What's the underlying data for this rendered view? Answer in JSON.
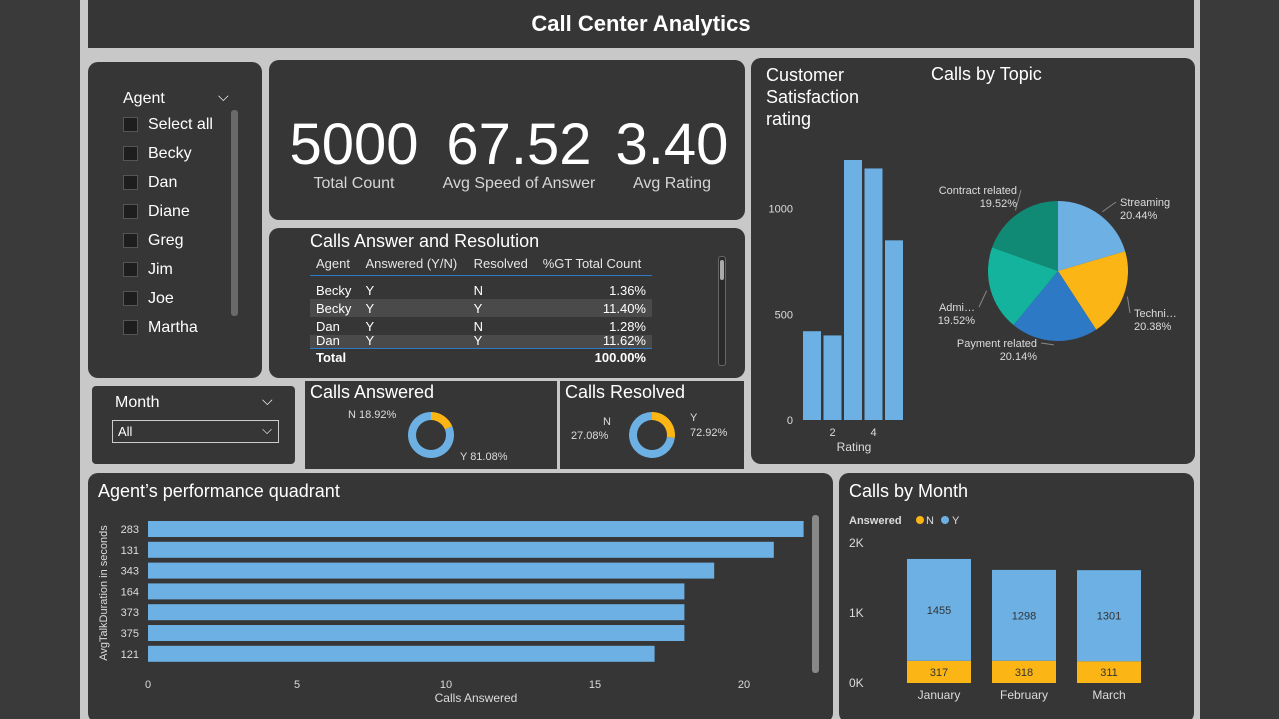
{
  "header": {
    "title": "Call Center Analytics"
  },
  "agent_slicer": {
    "label": "Agent",
    "items": [
      {
        "label": "Select all"
      },
      {
        "label": "Becky"
      },
      {
        "label": "Dan"
      },
      {
        "label": "Diane"
      },
      {
        "label": "Greg"
      },
      {
        "label": "Jim"
      },
      {
        "label": "Joe"
      },
      {
        "label": "Martha"
      }
    ]
  },
  "month_slicer": {
    "label": "Month",
    "value": "All"
  },
  "kpis": [
    {
      "value": "5000",
      "label": "Total Count"
    },
    {
      "value": "67.52",
      "label": "Avg Speed of Answer"
    },
    {
      "value": "3.40",
      "label": "Avg Rating"
    }
  ],
  "resolution_table": {
    "title": "Calls Answer and Resolution",
    "headers": [
      "Agent",
      "Answered (Y/N)",
      "Resolved",
      "%GT Total Count"
    ],
    "rows": [
      [
        "Becky",
        "Y",
        "N",
        "1.36%"
      ],
      [
        "Becky",
        "Y",
        "Y",
        "11.40%"
      ],
      [
        "Dan",
        "Y",
        "N",
        "1.28%"
      ],
      [
        "Dan",
        "Y",
        "Y",
        "11.62%"
      ]
    ],
    "total_label": "Total",
    "total_value": "100.00%"
  },
  "colors": {
    "blue": "#6cb0e4",
    "yellow": "#fbb615",
    "panel": "#363636"
  },
  "chart_data": [
    {
      "type": "donut",
      "title": "Calls Answered",
      "categories": [
        "N",
        "Y"
      ],
      "values": [
        18.92,
        81.08
      ],
      "labels": [
        "N 18.92%",
        "Y 81.08%"
      ]
    },
    {
      "type": "donut",
      "title": "Calls Resolved",
      "categories": [
        "N",
        "Y"
      ],
      "values": [
        27.08,
        72.92
      ],
      "labels": [
        "N",
        "27.08%",
        "Y",
        "72.92%"
      ]
    },
    {
      "type": "bar",
      "title": "Customer Satisfaction rating",
      "xlabel": "Rating",
      "categories": [
        1,
        2,
        3,
        4,
        5
      ],
      "values": [
        420,
        400,
        1230,
        1190,
        850
      ],
      "ylim": [
        0,
        1300
      ],
      "yticks": [
        0,
        500,
        1000
      ],
      "xticks": [
        2,
        4
      ]
    },
    {
      "type": "pie",
      "title": "Calls by Topic",
      "categories": [
        "Streaming",
        "Technical Support",
        "Payment related",
        "Admin Support",
        "Contract related"
      ],
      "values": [
        20.44,
        20.38,
        20.14,
        19.52,
        19.52
      ],
      "display_names": [
        "Streaming",
        "Techni…",
        "Payment related",
        "Admi…",
        "Contract related"
      ],
      "percent_labels": [
        "20.44%",
        "20.38%",
        "20.14%",
        "19.52%",
        "19.52%"
      ],
      "colors": [
        "#6cb0e4",
        "#fbb615",
        "#2e79c6",
        "#14b39d",
        "#118a75"
      ]
    },
    {
      "type": "bar",
      "orientation": "horizontal",
      "title": "Agent’s performance quadrant",
      "xlabel": "Calls Answered",
      "ylabel": "AvgTalkDuration in seconds",
      "categories": [
        "283",
        "131",
        "343",
        "164",
        "373",
        "375",
        "121"
      ],
      "values": [
        22,
        21,
        19,
        18,
        18,
        18,
        17
      ],
      "xlim": [
        0,
        22.5
      ],
      "xticks": [
        0,
        5,
        10,
        15,
        20
      ]
    },
    {
      "type": "bar",
      "stacked": true,
      "title": "Calls by Month",
      "legend_title": "Answered",
      "categories": [
        "January",
        "February",
        "March"
      ],
      "series": [
        {
          "name": "N",
          "values": [
            317,
            318,
            311
          ],
          "color": "#fbb615"
        },
        {
          "name": "Y",
          "values": [
            1455,
            1298,
            1301
          ],
          "color": "#6cb0e4"
        }
      ],
      "ylim": [
        0,
        2000
      ],
      "ytick_labels": [
        "0K",
        "1K",
        "2K"
      ]
    }
  ]
}
